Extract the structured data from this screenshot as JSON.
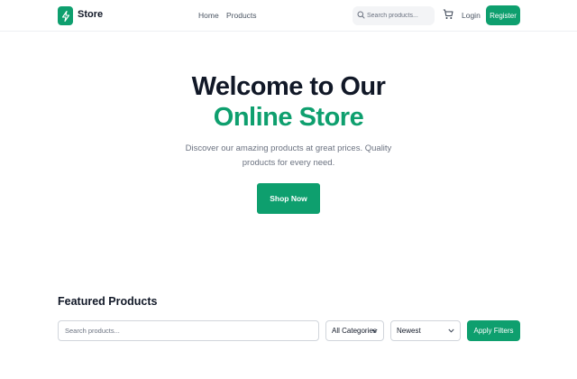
{
  "header": {
    "brand": "Store",
    "logo_icon": "lightning-bolt-icon",
    "nav": {
      "home": "Home",
      "products": "Products"
    },
    "search_placeholder": "Search products...",
    "login_label": "Login",
    "register_label": "Register",
    "cart_icon": "shopping-cart-icon"
  },
  "hero": {
    "title_line1": "Welcome to Our",
    "title_line2": "Online Store",
    "subtitle": "Discover our amazing products at great prices. Quality products for every need.",
    "cta_label": "Shop Now"
  },
  "featured": {
    "title": "Featured Products",
    "search_placeholder": "Search products...",
    "category_selected": "All Categories",
    "sort_selected": "Newest",
    "apply_label": "Apply Filters"
  },
  "colors": {
    "accent": "#0e9f6e",
    "text_dark": "#111827",
    "text_muted": "#6b7280"
  }
}
